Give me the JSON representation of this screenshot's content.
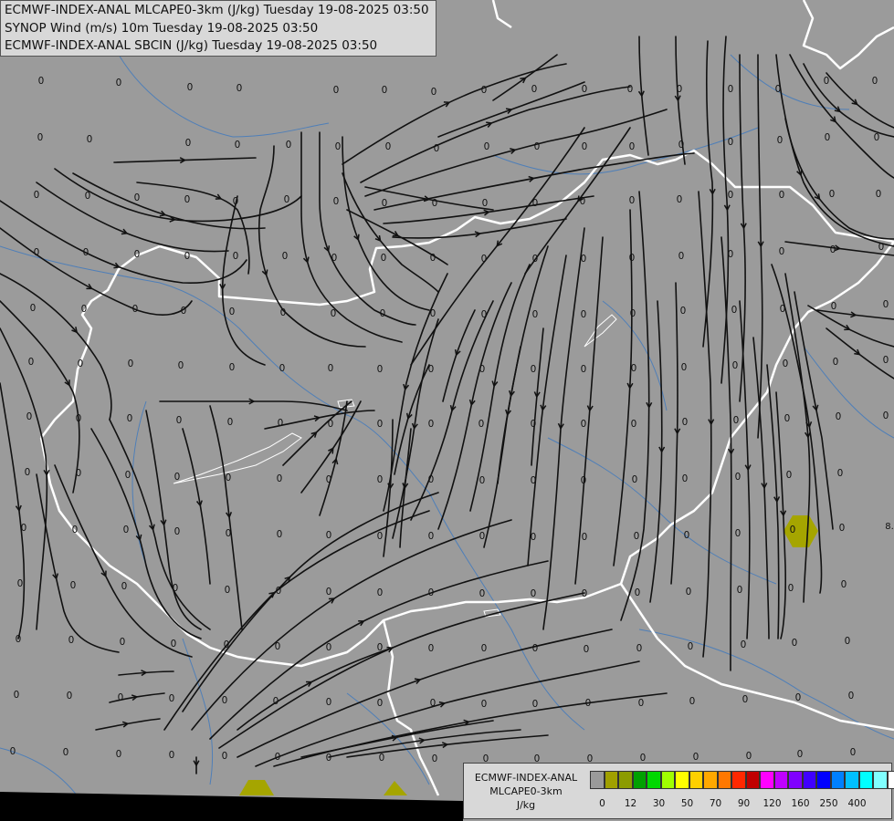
{
  "header": {
    "line1": "ECMWF-INDEX-ANAL MLCAPE0-3km (J/kg) Tuesday 19-08-2025 03:50",
    "line2": "SYNOP Wind (m/s) 10m Tuesday 19-08-2025 03:50",
    "line3": "ECMWF-INDEX-ANAL SBCIN (J/kg) Tuesday 19-08-2025 03:50"
  },
  "legend": {
    "title_line1": "ECMWF-INDEX-ANAL",
    "title_line2": "MLCAPE0-3km",
    "unit": "J/kg",
    "colors": [
      "#9a9a9a",
      "#a0a000",
      "#8c9c00",
      "#00a000",
      "#00d800",
      "#a0ff00",
      "#ffff00",
      "#ffd000",
      "#ffa800",
      "#ff7800",
      "#ff2800",
      "#c00000",
      "#ff00ff",
      "#c000ff",
      "#8000ff",
      "#4000ff",
      "#0000ff",
      "#0080ff",
      "#00c0ff",
      "#00ffff",
      "#80ffff",
      "#ffffff"
    ],
    "ticks": [
      "0",
      "12",
      "30",
      "50",
      "70",
      "90",
      "120",
      "160",
      "250",
      "400"
    ]
  },
  "map": {
    "value_label": "0",
    "edge_label": "8.",
    "stations": [
      [
        45,
        88
      ],
      [
        130,
        90
      ],
      [
        208,
        95
      ],
      [
        262,
        96
      ],
      [
        368,
        98
      ],
      [
        421,
        98
      ],
      [
        475,
        100
      ],
      [
        530,
        98
      ],
      [
        585,
        97
      ],
      [
        640,
        97
      ],
      [
        690,
        97
      ],
      [
        744,
        97
      ],
      [
        800,
        97
      ],
      [
        852,
        97
      ],
      [
        905,
        88
      ],
      [
        958,
        88
      ],
      [
        44,
        150
      ],
      [
        98,
        152
      ],
      [
        206,
        156
      ],
      [
        260,
        158
      ],
      [
        316,
        158
      ],
      [
        370,
        160
      ],
      [
        425,
        160
      ],
      [
        478,
        162
      ],
      [
        533,
        160
      ],
      [
        588,
        160
      ],
      [
        640,
        160
      ],
      [
        692,
        160
      ],
      [
        746,
        158
      ],
      [
        800,
        155
      ],
      [
        854,
        153
      ],
      [
        906,
        150
      ],
      [
        960,
        150
      ],
      [
        40,
        213
      ],
      [
        96,
        214
      ],
      [
        150,
        216
      ],
      [
        205,
        218
      ],
      [
        258,
        220
      ],
      [
        314,
        218
      ],
      [
        368,
        220
      ],
      [
        421,
        222
      ],
      [
        476,
        222
      ],
      [
        531,
        222
      ],
      [
        586,
        222
      ],
      [
        638,
        220
      ],
      [
        692,
        219
      ],
      [
        744,
        218
      ],
      [
        800,
        213
      ],
      [
        856,
        213
      ],
      [
        911,
        212
      ],
      [
        962,
        212
      ],
      [
        40,
        276
      ],
      [
        94,
        276
      ],
      [
        150,
        278
      ],
      [
        205,
        280
      ],
      [
        258,
        280
      ],
      [
        312,
        280
      ],
      [
        366,
        282
      ],
      [
        420,
        282
      ],
      [
        474,
        282
      ],
      [
        530,
        283
      ],
      [
        586,
        283
      ],
      [
        639,
        283
      ],
      [
        692,
        282
      ],
      [
        746,
        280
      ],
      [
        800,
        278
      ],
      [
        856,
        275
      ],
      [
        912,
        273
      ],
      [
        965,
        270
      ],
      [
        36,
        337
      ],
      [
        92,
        338
      ],
      [
        148,
        338
      ],
      [
        201,
        340
      ],
      [
        254,
        341
      ],
      [
        310,
        342
      ],
      [
        365,
        343
      ],
      [
        419,
        343
      ],
      [
        474,
        343
      ],
      [
        530,
        344
      ],
      [
        586,
        344
      ],
      [
        639,
        344
      ],
      [
        693,
        343
      ],
      [
        748,
        340
      ],
      [
        804,
        339
      ],
      [
        857,
        338
      ],
      [
        913,
        335
      ],
      [
        970,
        333
      ],
      [
        34,
        396
      ],
      [
        88,
        398
      ],
      [
        143,
        398
      ],
      [
        198,
        400
      ],
      [
        254,
        402
      ],
      [
        309,
        403
      ],
      [
        362,
        403
      ],
      [
        416,
        404
      ],
      [
        472,
        404
      ],
      [
        528,
        404
      ],
      [
        584,
        404
      ],
      [
        639,
        404
      ],
      [
        694,
        403
      ],
      [
        749,
        402
      ],
      [
        805,
        400
      ],
      [
        860,
        398
      ],
      [
        915,
        396
      ],
      [
        970,
        394
      ],
      [
        32,
        456
      ],
      [
        86,
        458
      ],
      [
        142,
        458
      ],
      [
        196,
        460
      ],
      [
        252,
        462
      ],
      [
        307,
        463
      ],
      [
        362,
        464
      ],
      [
        416,
        464
      ],
      [
        472,
        464
      ],
      [
        527,
        464
      ],
      [
        584,
        464
      ],
      [
        639,
        464
      ],
      [
        694,
        464
      ],
      [
        750,
        462
      ],
      [
        806,
        460
      ],
      [
        862,
        458
      ],
      [
        918,
        456
      ],
      [
        970,
        455
      ],
      [
        30,
        517
      ],
      [
        86,
        518
      ],
      [
        140,
        520
      ],
      [
        194,
        522
      ],
      [
        250,
        523
      ],
      [
        306,
        524
      ],
      [
        360,
        525
      ],
      [
        416,
        525
      ],
      [
        472,
        525
      ],
      [
        528,
        526
      ],
      [
        584,
        526
      ],
      [
        639,
        526
      ],
      [
        695,
        525
      ],
      [
        750,
        524
      ],
      [
        808,
        522
      ],
      [
        864,
        520
      ],
      [
        920,
        518
      ],
      [
        26,
        578
      ],
      [
        82,
        580
      ],
      [
        138,
        580
      ],
      [
        194,
        582
      ],
      [
        250,
        584
      ],
      [
        306,
        585
      ],
      [
        360,
        586
      ],
      [
        416,
        587
      ],
      [
        472,
        587
      ],
      [
        528,
        587
      ],
      [
        584,
        588
      ],
      [
        640,
        588
      ],
      [
        697,
        587
      ],
      [
        752,
        586
      ],
      [
        808,
        584
      ],
      [
        868,
        580
      ],
      [
        922,
        578
      ],
      [
        22,
        639
      ],
      [
        80,
        641
      ],
      [
        136,
        642
      ],
      [
        192,
        644
      ],
      [
        249,
        646
      ],
      [
        305,
        647
      ],
      [
        360,
        648
      ],
      [
        416,
        649
      ],
      [
        472,
        649
      ],
      [
        528,
        650
      ],
      [
        584,
        650
      ],
      [
        640,
        650
      ],
      [
        698,
        649
      ],
      [
        754,
        648
      ],
      [
        810,
        646
      ],
      [
        866,
        644
      ],
      [
        924,
        640
      ],
      [
        20,
        700
      ],
      [
        78,
        701
      ],
      [
        134,
        703
      ],
      [
        190,
        705
      ],
      [
        248,
        706
      ],
      [
        304,
        708
      ],
      [
        360,
        709
      ],
      [
        416,
        709
      ],
      [
        472,
        710
      ],
      [
        530,
        710
      ],
      [
        586,
        710
      ],
      [
        642,
        711
      ],
      [
        700,
        710
      ],
      [
        756,
        708
      ],
      [
        814,
        706
      ],
      [
        870,
        704
      ],
      [
        928,
        702
      ],
      [
        18,
        761
      ],
      [
        76,
        762
      ],
      [
        132,
        764
      ],
      [
        188,
        765
      ],
      [
        246,
        767
      ],
      [
        302,
        768
      ],
      [
        360,
        769
      ],
      [
        416,
        770
      ],
      [
        474,
        770
      ],
      [
        530,
        771
      ],
      [
        586,
        771
      ],
      [
        644,
        770
      ],
      [
        702,
        770
      ],
      [
        758,
        768
      ],
      [
        816,
        766
      ],
      [
        874,
        764
      ],
      [
        932,
        762
      ],
      [
        14,
        823
      ],
      [
        72,
        824
      ],
      [
        130,
        826
      ],
      [
        188,
        827
      ],
      [
        246,
        828
      ],
      [
        304,
        829
      ],
      [
        360,
        830
      ],
      [
        418,
        830
      ],
      [
        476,
        831
      ],
      [
        532,
        831
      ],
      [
        588,
        831
      ],
      [
        646,
        831
      ],
      [
        704,
        830
      ],
      [
        762,
        829
      ],
      [
        820,
        828
      ],
      [
        876,
        826
      ],
      [
        934,
        824
      ]
    ]
  }
}
